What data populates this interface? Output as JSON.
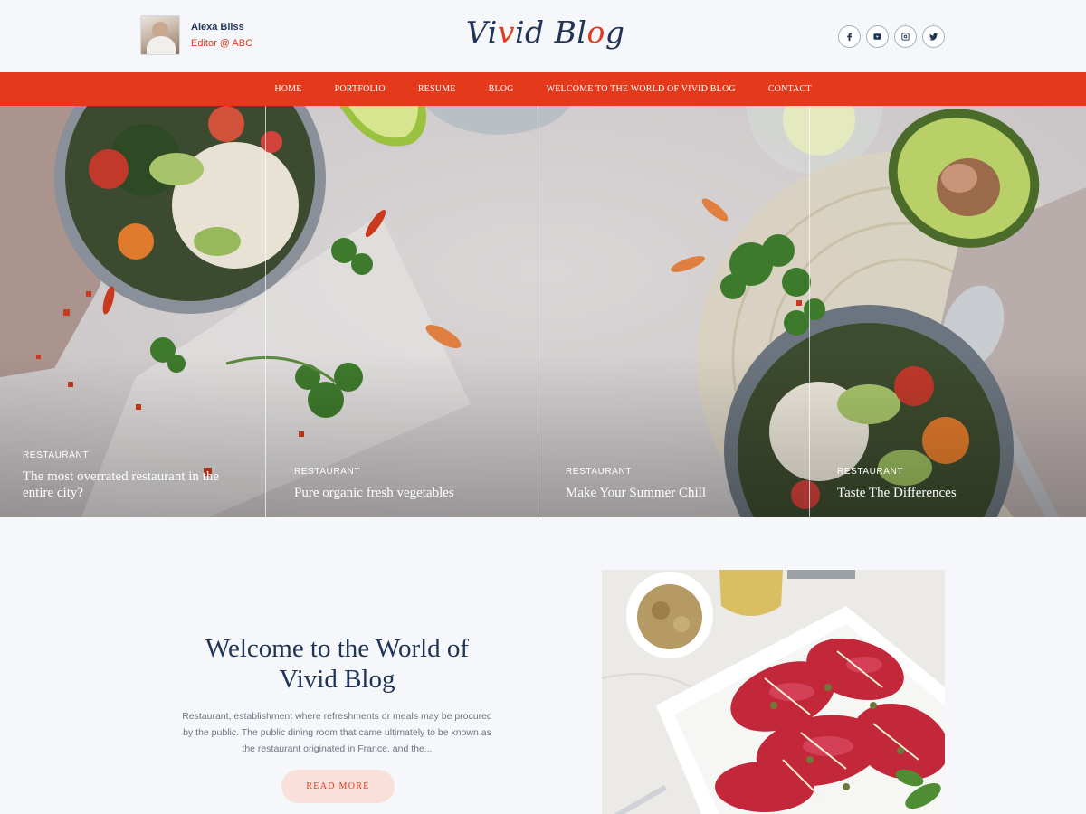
{
  "author": {
    "name": "Alexa Bliss",
    "role": "Editor @ ABC"
  },
  "logo": {
    "part1": "Vi",
    "accent1": "v",
    "part2": "id Bl",
    "accent2": "o",
    "part3": "g"
  },
  "social": {
    "icons": [
      "facebook-icon",
      "youtube-icon",
      "instagram-icon",
      "twitter-icon"
    ]
  },
  "nav": {
    "items": [
      "HOME",
      "PORTFOLIO",
      "RESUME",
      "BLOG",
      "WELCOME TO THE WORLD OF VIVID BLOG",
      "CONTACT"
    ]
  },
  "slides": [
    {
      "category": "RESTAURANT",
      "title": "The most overrated restaurant in the entire city?"
    },
    {
      "category": "RESTAURANT",
      "title": "Pure organic fresh vegetables"
    },
    {
      "category": "RESTAURANT",
      "title": "Make Your Summer Chill"
    },
    {
      "category": "RESTAURANT",
      "title": "Taste The Differences"
    }
  ],
  "intro": {
    "title": "Welcome to the World of Vivid Blog",
    "text": "Restaurant, establishment where refreshments or meals may be procured by the public. The public dining room that came ultimately to be known as the restaurant originated in France, and the...",
    "button": "READ MORE"
  },
  "colors": {
    "accent": "#e4391b",
    "navy": "#1f3456",
    "background": "#f5f7fa"
  }
}
